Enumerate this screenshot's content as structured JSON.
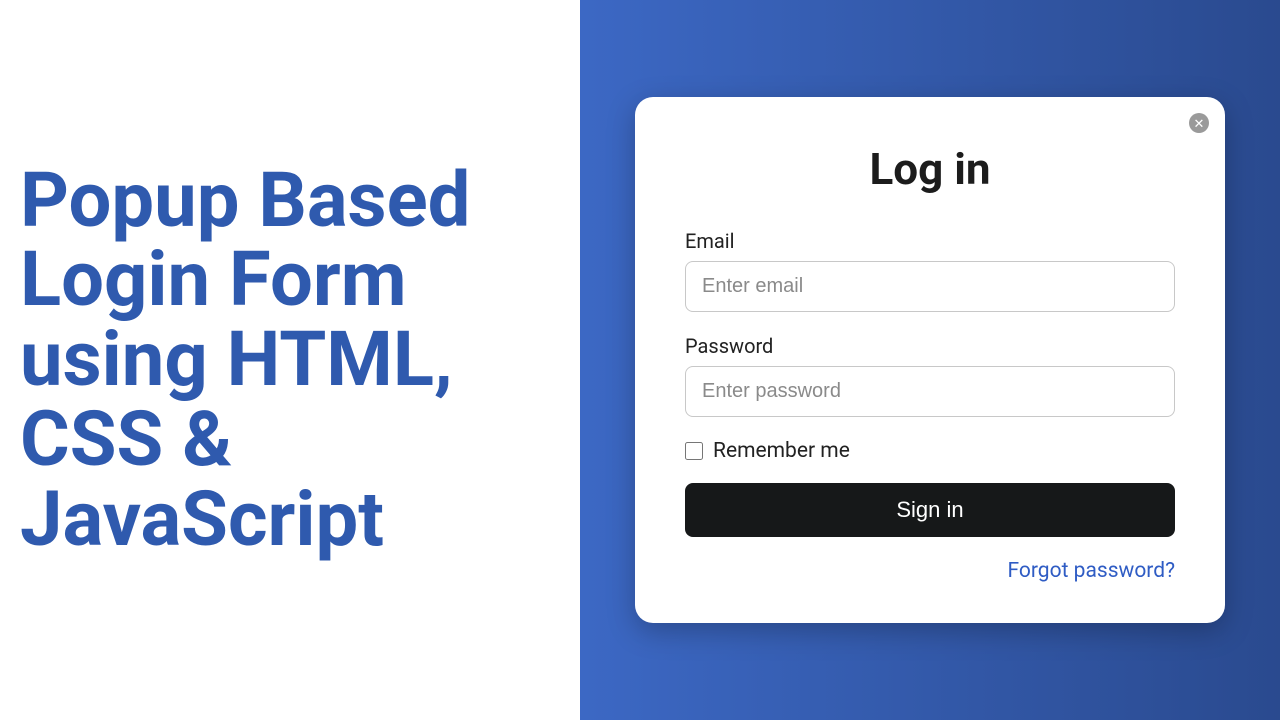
{
  "left": {
    "title": "Popup Based Login Form using HTML, CSS & JavaScript"
  },
  "login": {
    "title": "Log in",
    "email_label": "Email",
    "email_placeholder": "Enter email",
    "password_label": "Password",
    "password_placeholder": "Enter password",
    "remember_label": "Remember me",
    "signin_label": "Sign in",
    "forgot_label": "Forgot password?"
  }
}
